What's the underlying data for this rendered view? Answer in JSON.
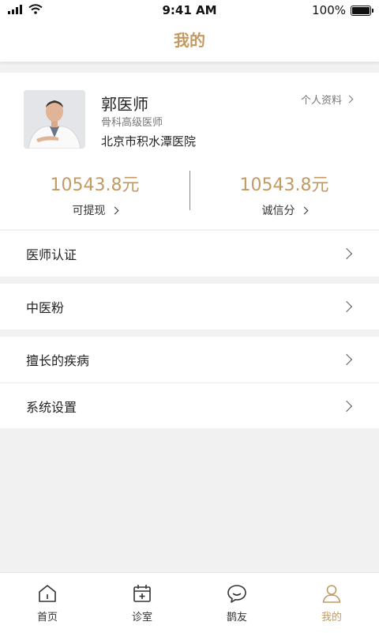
{
  "status_bar": {
    "time": "9:41 AM",
    "battery": "100%"
  },
  "nav": {
    "title": "我的"
  },
  "profile": {
    "name": "郭医师",
    "title": "骨科高级医师",
    "hospital": "北京市积水潭医院",
    "profile_link": "个人资料"
  },
  "stats": [
    {
      "value": "10543.8元",
      "label": "可提现"
    },
    {
      "value": "10543.8元",
      "label": "诚信分"
    }
  ],
  "menu": {
    "group1": [
      {
        "label": "医师认证"
      }
    ],
    "group2": [
      {
        "label": "中医粉"
      }
    ],
    "group3": [
      {
        "label": "擅长的疾病"
      },
      {
        "label": "系统设置"
      }
    ]
  },
  "tabs": [
    {
      "label": "首页",
      "icon": "home-icon"
    },
    {
      "label": "诊室",
      "icon": "calendar-icon"
    },
    {
      "label": "鹊友",
      "icon": "chat-bubble-icon"
    },
    {
      "label": "我的",
      "icon": "person-icon",
      "active": true
    }
  ],
  "colors": {
    "accent": "#c29a62",
    "background": "#f2f1f1"
  }
}
